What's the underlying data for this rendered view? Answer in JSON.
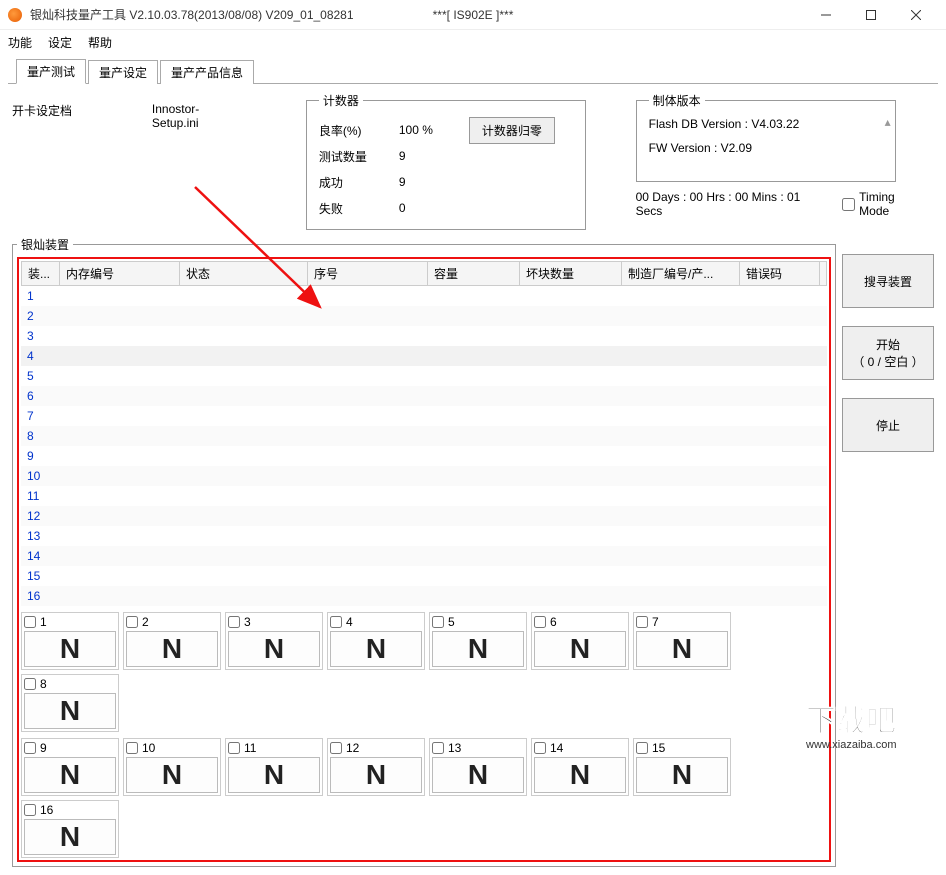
{
  "title": "银灿科技量产工具 V2.10.03.78(2013/08/08)     V209_01_08281",
  "title_center": "***[ IS902E ]***",
  "menu": {
    "function": "功能",
    "settings": "设定",
    "help": "帮助"
  },
  "tabs": {
    "test": "量产测试",
    "settings": "量产设定",
    "product": "量产产品信息"
  },
  "card": {
    "label": "开卡设定档",
    "value": "Innostor-Setup.ini"
  },
  "counter": {
    "legend": "计数器",
    "yield_label": "良率(%)",
    "yield_value": "100 %",
    "testcount_label": "测试数量",
    "testcount_value": "9",
    "success_label": "成功",
    "success_value": "9",
    "fail_label": "失败",
    "fail_value": "0",
    "reset_btn": "计数器归零"
  },
  "fw": {
    "legend": "制体版本",
    "flashdb": "Flash DB Version :  V4.03.22",
    "fwver": "FW Version :   V2.09"
  },
  "timing": {
    "elapsed": "00 Days : 00 Hrs : 00 Mins : 01 Secs",
    "mode_label": "Timing Mode"
  },
  "devices": {
    "legend": "银灿装置",
    "headers": [
      "装...",
      "内存编号",
      "状态",
      "序号",
      "容量",
      "坏块数量",
      "制造厂编号/产...",
      "错误码"
    ],
    "rows": [
      "1",
      "2",
      "3",
      "4",
      "5",
      "6",
      "7",
      "8",
      "9",
      "10",
      "11",
      "12",
      "13",
      "14",
      "15",
      "16"
    ],
    "slots_row1": [
      "1",
      "2",
      "3",
      "4",
      "5",
      "6",
      "7",
      "8"
    ],
    "slots_row2": [
      "9",
      "10",
      "11",
      "12",
      "13",
      "14",
      "15",
      "16"
    ],
    "slot_letter": "N"
  },
  "buttons": {
    "search": "搜寻装置",
    "start_line1": "开始",
    "start_line2": "（ 0 / 空白 ）",
    "stop": "停止"
  },
  "watermark": {
    "line1": "下载吧",
    "line2": "www.xiazaiba.com"
  }
}
